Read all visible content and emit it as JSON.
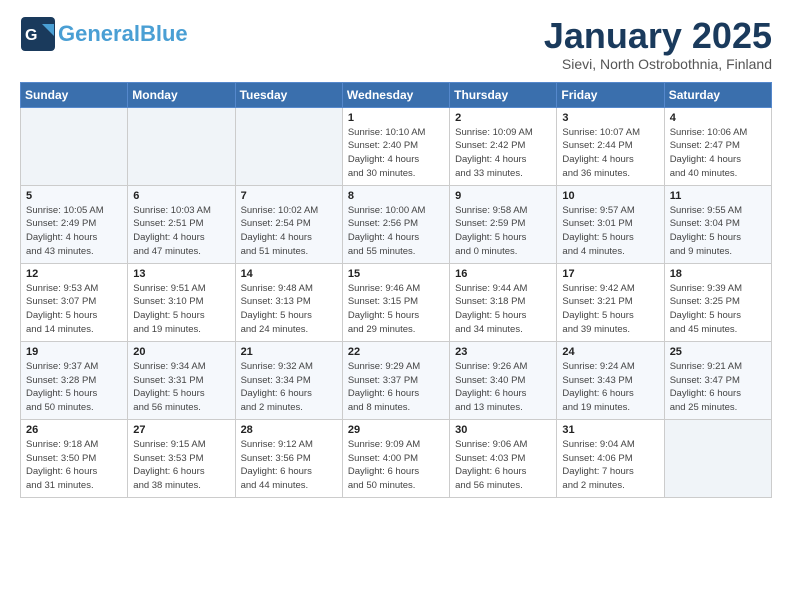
{
  "header": {
    "logo_general": "General",
    "logo_blue": "Blue",
    "title": "January 2025",
    "subtitle": "Sievi, North Ostrobothnia, Finland"
  },
  "weekdays": [
    "Sunday",
    "Monday",
    "Tuesday",
    "Wednesday",
    "Thursday",
    "Friday",
    "Saturday"
  ],
  "weeks": [
    [
      {
        "day": "",
        "detail": ""
      },
      {
        "day": "",
        "detail": ""
      },
      {
        "day": "",
        "detail": ""
      },
      {
        "day": "1",
        "detail": "Sunrise: 10:10 AM\nSunset: 2:40 PM\nDaylight: 4 hours\nand 30 minutes."
      },
      {
        "day": "2",
        "detail": "Sunrise: 10:09 AM\nSunset: 2:42 PM\nDaylight: 4 hours\nand 33 minutes."
      },
      {
        "day": "3",
        "detail": "Sunrise: 10:07 AM\nSunset: 2:44 PM\nDaylight: 4 hours\nand 36 minutes."
      },
      {
        "day": "4",
        "detail": "Sunrise: 10:06 AM\nSunset: 2:47 PM\nDaylight: 4 hours\nand 40 minutes."
      }
    ],
    [
      {
        "day": "5",
        "detail": "Sunrise: 10:05 AM\nSunset: 2:49 PM\nDaylight: 4 hours\nand 43 minutes."
      },
      {
        "day": "6",
        "detail": "Sunrise: 10:03 AM\nSunset: 2:51 PM\nDaylight: 4 hours\nand 47 minutes."
      },
      {
        "day": "7",
        "detail": "Sunrise: 10:02 AM\nSunset: 2:54 PM\nDaylight: 4 hours\nand 51 minutes."
      },
      {
        "day": "8",
        "detail": "Sunrise: 10:00 AM\nSunset: 2:56 PM\nDaylight: 4 hours\nand 55 minutes."
      },
      {
        "day": "9",
        "detail": "Sunrise: 9:58 AM\nSunset: 2:59 PM\nDaylight: 5 hours\nand 0 minutes."
      },
      {
        "day": "10",
        "detail": "Sunrise: 9:57 AM\nSunset: 3:01 PM\nDaylight: 5 hours\nand 4 minutes."
      },
      {
        "day": "11",
        "detail": "Sunrise: 9:55 AM\nSunset: 3:04 PM\nDaylight: 5 hours\nand 9 minutes."
      }
    ],
    [
      {
        "day": "12",
        "detail": "Sunrise: 9:53 AM\nSunset: 3:07 PM\nDaylight: 5 hours\nand 14 minutes."
      },
      {
        "day": "13",
        "detail": "Sunrise: 9:51 AM\nSunset: 3:10 PM\nDaylight: 5 hours\nand 19 minutes."
      },
      {
        "day": "14",
        "detail": "Sunrise: 9:48 AM\nSunset: 3:13 PM\nDaylight: 5 hours\nand 24 minutes."
      },
      {
        "day": "15",
        "detail": "Sunrise: 9:46 AM\nSunset: 3:15 PM\nDaylight: 5 hours\nand 29 minutes."
      },
      {
        "day": "16",
        "detail": "Sunrise: 9:44 AM\nSunset: 3:18 PM\nDaylight: 5 hours\nand 34 minutes."
      },
      {
        "day": "17",
        "detail": "Sunrise: 9:42 AM\nSunset: 3:21 PM\nDaylight: 5 hours\nand 39 minutes."
      },
      {
        "day": "18",
        "detail": "Sunrise: 9:39 AM\nSunset: 3:25 PM\nDaylight: 5 hours\nand 45 minutes."
      }
    ],
    [
      {
        "day": "19",
        "detail": "Sunrise: 9:37 AM\nSunset: 3:28 PM\nDaylight: 5 hours\nand 50 minutes."
      },
      {
        "day": "20",
        "detail": "Sunrise: 9:34 AM\nSunset: 3:31 PM\nDaylight: 5 hours\nand 56 minutes."
      },
      {
        "day": "21",
        "detail": "Sunrise: 9:32 AM\nSunset: 3:34 PM\nDaylight: 6 hours\nand 2 minutes."
      },
      {
        "day": "22",
        "detail": "Sunrise: 9:29 AM\nSunset: 3:37 PM\nDaylight: 6 hours\nand 8 minutes."
      },
      {
        "day": "23",
        "detail": "Sunrise: 9:26 AM\nSunset: 3:40 PM\nDaylight: 6 hours\nand 13 minutes."
      },
      {
        "day": "24",
        "detail": "Sunrise: 9:24 AM\nSunset: 3:43 PM\nDaylight: 6 hours\nand 19 minutes."
      },
      {
        "day": "25",
        "detail": "Sunrise: 9:21 AM\nSunset: 3:47 PM\nDaylight: 6 hours\nand 25 minutes."
      }
    ],
    [
      {
        "day": "26",
        "detail": "Sunrise: 9:18 AM\nSunset: 3:50 PM\nDaylight: 6 hours\nand 31 minutes."
      },
      {
        "day": "27",
        "detail": "Sunrise: 9:15 AM\nSunset: 3:53 PM\nDaylight: 6 hours\nand 38 minutes."
      },
      {
        "day": "28",
        "detail": "Sunrise: 9:12 AM\nSunset: 3:56 PM\nDaylight: 6 hours\nand 44 minutes."
      },
      {
        "day": "29",
        "detail": "Sunrise: 9:09 AM\nSunset: 4:00 PM\nDaylight: 6 hours\nand 50 minutes."
      },
      {
        "day": "30",
        "detail": "Sunrise: 9:06 AM\nSunset: 4:03 PM\nDaylight: 6 hours\nand 56 minutes."
      },
      {
        "day": "31",
        "detail": "Sunrise: 9:04 AM\nSunset: 4:06 PM\nDaylight: 7 hours\nand 2 minutes."
      },
      {
        "day": "",
        "detail": ""
      }
    ]
  ]
}
